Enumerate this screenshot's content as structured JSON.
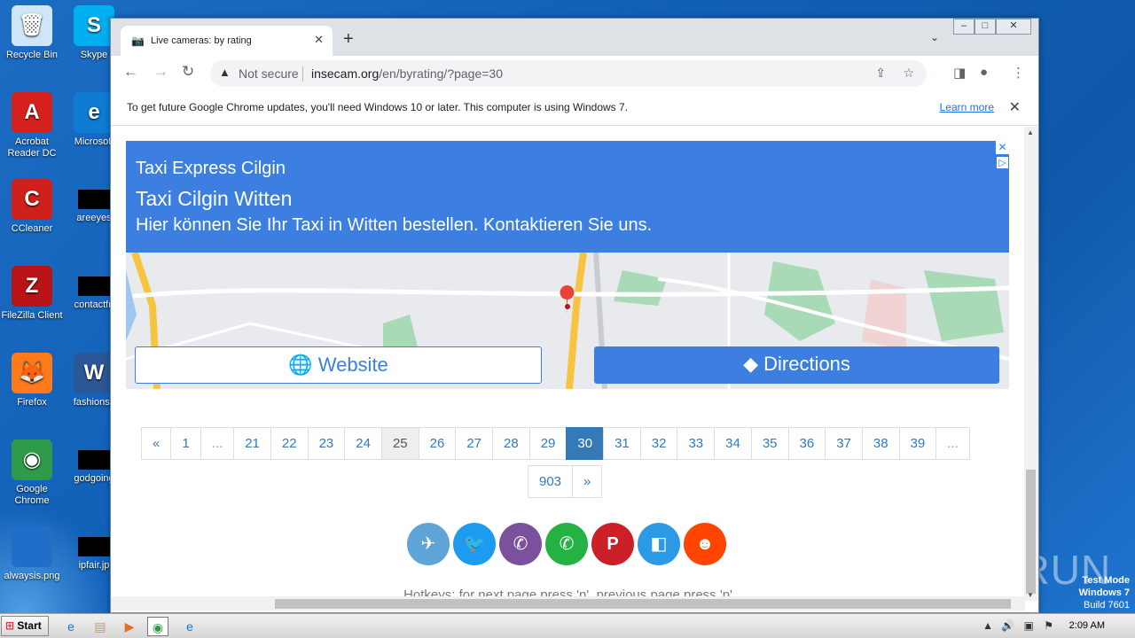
{
  "desktop": {
    "icons": [
      {
        "label": "Recycle Bin",
        "glyph": "🗑",
        "color": "#cfe6f7"
      },
      {
        "label": "Skype",
        "glyph": "S",
        "color": "#00aff0"
      },
      {
        "label": "Acrobat Reader DC",
        "glyph": "A",
        "color": "#d6201c"
      },
      {
        "label": "Microsoft",
        "glyph": "e",
        "color": "#0f7bd3"
      },
      {
        "label": "CCleaner",
        "glyph": "C",
        "color": "#d0201c"
      },
      {
        "label": "areeyes",
        "glyph": "",
        "color": "#000000"
      },
      {
        "label": "FileZilla Client",
        "glyph": "Z",
        "color": "#b81418"
      },
      {
        "label": "contactfri",
        "glyph": "",
        "color": "#000000"
      },
      {
        "label": "Firefox",
        "glyph": "🦊",
        "color": "#ff7a1a"
      },
      {
        "label": "fashionsy",
        "glyph": "W",
        "color": "#2b5797"
      },
      {
        "label": "Google Chrome",
        "glyph": "◉",
        "color": "#2e9b4a"
      },
      {
        "label": "godgoing",
        "glyph": "",
        "color": "#000000"
      },
      {
        "label": "alwaysis.png",
        "glyph": "",
        "color": "#1f6fc8"
      },
      {
        "label": "ipfair.jp",
        "glyph": "",
        "color": "#000000"
      }
    ]
  },
  "browser": {
    "tab_title": "Live cameras: by rating",
    "tab_favicon": "camera-icon",
    "omnibox": {
      "security_label": "Not secure",
      "url_host": "insecam.org",
      "url_path": "/en/byrating/?page=30"
    },
    "infobar": {
      "message": "To get future Google Chrome updates, you'll need Windows 10 or later. This computer is using Windows 7.",
      "link": "Learn more"
    }
  },
  "ad": {
    "line1": "Taxi Express Cilgin",
    "line2": "Taxi Cilgin Witten",
    "line3": "Hier können Sie Ihr Taxi in Witten bestellen. Kontaktieren Sie uns.",
    "website_label": "Website",
    "directions_label": "Directions",
    "colors": {
      "brand": "#3d7fe0"
    }
  },
  "pagination": {
    "row1": [
      "«",
      "1",
      "...",
      "21",
      "22",
      "23",
      "24",
      "25",
      "26",
      "27",
      "28",
      "29",
      "30",
      "31",
      "32",
      "33",
      "34",
      "35",
      "36",
      "37",
      "38",
      "39",
      "..."
    ],
    "row2": [
      "903",
      "»"
    ],
    "current": "30",
    "hovered": "25"
  },
  "share": [
    {
      "name": "telegram",
      "glyph": "✈",
      "color": "#5fa4d6"
    },
    {
      "name": "twitter",
      "glyph": "🐦",
      "color": "#1d9bf0"
    },
    {
      "name": "viber",
      "glyph": "✆",
      "color": "#7b519d"
    },
    {
      "name": "whatsapp",
      "glyph": "✆",
      "color": "#25b244"
    },
    {
      "name": "pinterest",
      "glyph": "P",
      "color": "#cb2027"
    },
    {
      "name": "delicious",
      "glyph": "◧",
      "color": "#2d9ae8"
    },
    {
      "name": "reddit",
      "glyph": "☻",
      "color": "#ff4500"
    }
  ],
  "hotkeys": "Hotkeys: for next page press 'n', previous page press 'p'",
  "os": {
    "watermark": "ANY RUN",
    "test_mode_line1": "Test Mode",
    "test_mode_line2": "Windows 7",
    "test_mode_line3": "Build 7601",
    "start_label": "Start",
    "clock": "2:09 AM"
  }
}
